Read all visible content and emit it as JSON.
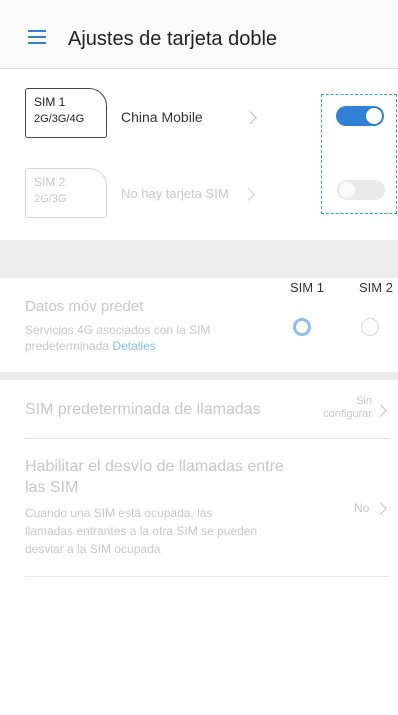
{
  "header": {
    "title": "Ajustes de tarjeta doble",
    "menu_icon": "menu-icon"
  },
  "sims": [
    {
      "slot": "SIM 1",
      "bands": "2G/3G/4G",
      "carrier": "China Mobile",
      "enabled": true
    },
    {
      "slot": "SIM 2",
      "bands": "2G/3G",
      "carrier": "No hay tarjeta SIM",
      "enabled": false
    }
  ],
  "columns": {
    "sim1": "SIM 1",
    "sim2": "SIM 2"
  },
  "data_default": {
    "title": "Datos móv predet",
    "desc_line1": "Servicios 4G asociados con la SIM",
    "desc_line2": "predeterminada",
    "link": "Detalles",
    "selected": "SIM 1"
  },
  "call_default": {
    "title": "SIM predeterminada de llamadas",
    "value_line1": "Sin",
    "value_line2": "configurar"
  },
  "forwarding": {
    "title_line1": "Habilitar el desvío de llamadas entre",
    "title_line2": "las SIM",
    "desc_line1": "Cuando una SIM está ocupada, las",
    "desc_line2": "llamadas entrantes a la otra SIM se pueden",
    "desc_line3": "desviar a la SIM ocupada",
    "value": "No"
  },
  "colors": {
    "accent": "#2f80d6",
    "toggle_off": "#e6e6e6",
    "highlight_border": "#2aa6bd"
  }
}
